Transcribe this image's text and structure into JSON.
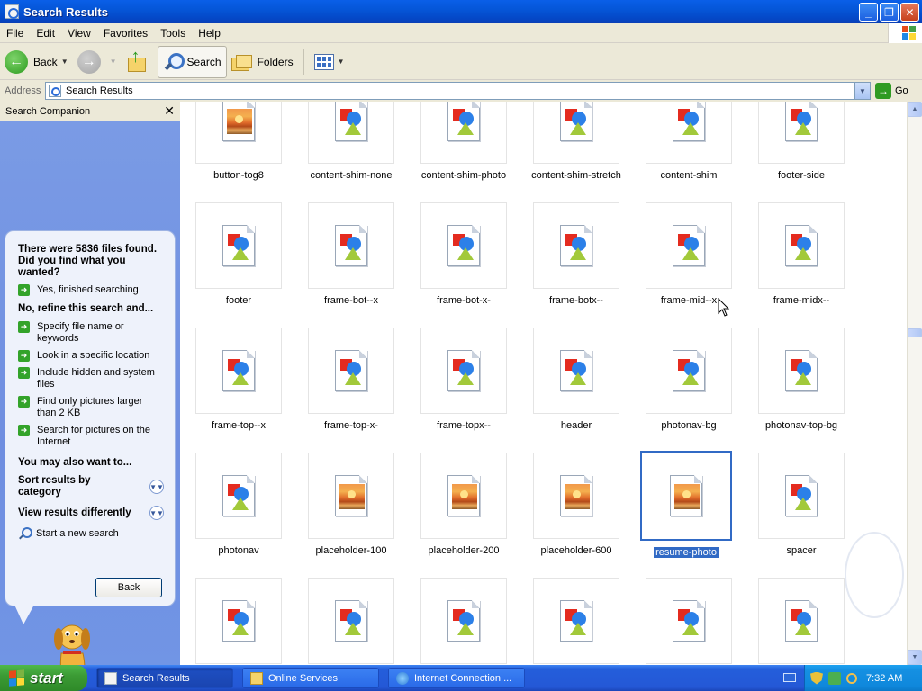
{
  "window": {
    "title": "Search Results",
    "buttons": [
      "_",
      "❐",
      "✕"
    ]
  },
  "menu": [
    "File",
    "Edit",
    "View",
    "Favorites",
    "Tools",
    "Help"
  ],
  "toolbar": {
    "back_label": "Back",
    "search_label": "Search",
    "folders_label": "Folders"
  },
  "address": {
    "label": "Address",
    "value": "Search Results",
    "go_label": "Go"
  },
  "companion": {
    "title": "Search Companion",
    "close": "✕",
    "question": "There were 5836 files found. Did you find what you wanted?",
    "yes_option": "Yes, finished searching",
    "refine_heading": "No, refine this search and...",
    "refine_options": [
      "Specify file name or keywords",
      "Look in a specific location",
      "Include hidden and system files",
      "Find only pictures larger than 2 KB",
      "Search for pictures on the Internet"
    ],
    "also_heading": "You may also want to...",
    "sort_label": "Sort results by category",
    "view_label": "View results differently",
    "new_search": "Start a new search",
    "back_button": "Back"
  },
  "files": [
    {
      "name": "button-tog8",
      "type": "photo"
    },
    {
      "name": "content-shim-none",
      "type": "shapes"
    },
    {
      "name": "content-shim-photo",
      "type": "shapes"
    },
    {
      "name": "content-shim-stretch",
      "type": "shapes"
    },
    {
      "name": "content-shim",
      "type": "shapes"
    },
    {
      "name": "footer-side",
      "type": "shapes"
    },
    {
      "name": "footer",
      "type": "shapes"
    },
    {
      "name": "frame-bot--x",
      "type": "shapes"
    },
    {
      "name": "frame-bot-x-",
      "type": "shapes"
    },
    {
      "name": "frame-botx--",
      "type": "shapes"
    },
    {
      "name": "frame-mid--x",
      "type": "shapes"
    },
    {
      "name": "frame-midx--",
      "type": "shapes"
    },
    {
      "name": "frame-top--x",
      "type": "shapes"
    },
    {
      "name": "frame-top-x-",
      "type": "shapes"
    },
    {
      "name": "frame-topx--",
      "type": "shapes"
    },
    {
      "name": "header",
      "type": "shapes"
    },
    {
      "name": "photonav-bg",
      "type": "shapes"
    },
    {
      "name": "photonav-top-bg",
      "type": "shapes"
    },
    {
      "name": "photonav",
      "type": "shapes"
    },
    {
      "name": "placeholder-100",
      "type": "photo"
    },
    {
      "name": "placeholder-200",
      "type": "photo"
    },
    {
      "name": "placeholder-600",
      "type": "photo"
    },
    {
      "name": "resume-photo",
      "type": "photo",
      "selected": true
    },
    {
      "name": "spacer",
      "type": "shapes"
    },
    {
      "name": "",
      "type": "shapes"
    },
    {
      "name": "",
      "type": "shapes"
    },
    {
      "name": "",
      "type": "shapes"
    },
    {
      "name": "",
      "type": "shapes"
    },
    {
      "name": "",
      "type": "shapes"
    },
    {
      "name": "",
      "type": "shapes"
    }
  ],
  "taskbar": {
    "start_label": "start",
    "tasks": [
      {
        "label": "Search Results",
        "icon": "search-window-icon",
        "active": true
      },
      {
        "label": "Online Services",
        "icon": "folder-icon",
        "active": false
      },
      {
        "label": "Internet Connection ...",
        "icon": "network-wizard-icon",
        "active": false
      }
    ],
    "clock": "7:32 AM"
  }
}
